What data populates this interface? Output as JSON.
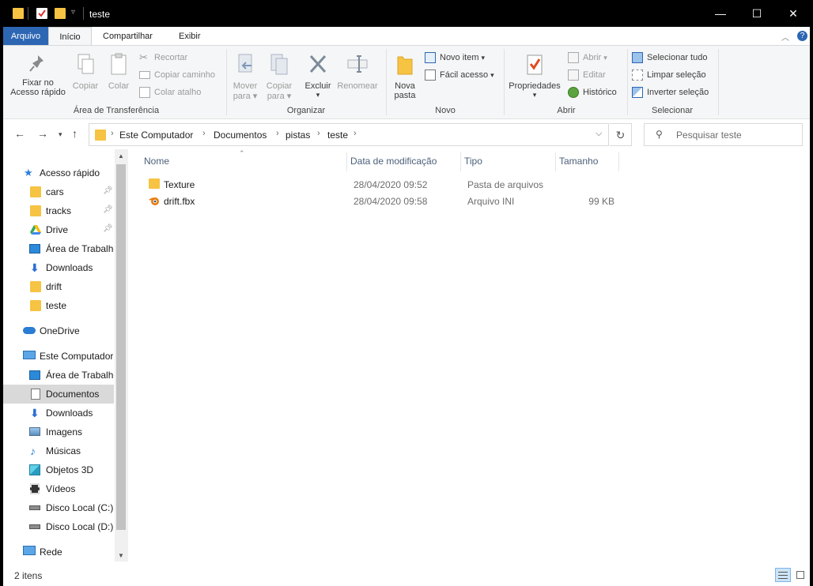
{
  "window": {
    "title": "teste"
  },
  "title_buttons": {
    "minimize": "—",
    "maximize": "☐",
    "close": "✕"
  },
  "ribbon_tabs": [
    "Arquivo",
    "Início",
    "Compartilhar",
    "Exibir"
  ],
  "ribbon": {
    "clipboard": {
      "pin_label_1": "Fixar no",
      "pin_label_2": "Acesso rápido",
      "copy": "Copiar",
      "paste": "Colar",
      "cut": "Recortar",
      "copy_path": "Copiar caminho",
      "paste_shortcut": "Colar atalho",
      "title": "Área de Transferência"
    },
    "organize": {
      "move_1": "Mover",
      "move_2": "para",
      "copyto_1": "Copiar",
      "copyto_2": "para",
      "delete": "Excluir",
      "rename": "Renomear",
      "title": "Organizar"
    },
    "new": {
      "newfolder_1": "Nova",
      "newfolder_2": "pasta",
      "new_item": "Novo item",
      "easy_access": "Fácil acesso",
      "title": "Novo"
    },
    "open": {
      "properties": "Propriedades",
      "open": "Abrir",
      "edit": "Editar",
      "history": "Histórico",
      "title": "Abrir"
    },
    "select": {
      "select_all": "Selecionar tudo",
      "clear": "Limpar seleção",
      "invert": "Inverter seleção",
      "title": "Selecionar"
    }
  },
  "address": {
    "crumbs": [
      "Este Computador",
      "Documentos",
      "pistas",
      "teste"
    ],
    "search_placeholder": "Pesquisar teste"
  },
  "nav": {
    "quick_access": "Acesso rápido",
    "quick_items": [
      "cars",
      "tracks",
      "Drive",
      "Área de Trabalho",
      "Downloads",
      "drift",
      "teste"
    ],
    "onedrive": "OneDrive",
    "this_pc": "Este Computador",
    "pc_items": [
      "Área de Trabalho",
      "Documentos",
      "Downloads",
      "Imagens",
      "Músicas",
      "Objetos 3D",
      "Vídeos",
      "Disco Local (C:)",
      "Disco Local (D:)"
    ],
    "network": "Rede"
  },
  "columns": [
    "Nome",
    "Data de modificação",
    "Tipo",
    "Tamanho"
  ],
  "files": [
    {
      "name": "Texture",
      "date": "28/04/2020 09:52",
      "type": "Pasta de arquivos",
      "size": "",
      "icon": "folder-icon"
    },
    {
      "name": "drift.fbx",
      "date": "28/04/2020 09:58",
      "type": "Arquivo INI",
      "size": "99 KB",
      "icon": "blender-icon"
    }
  ],
  "status": {
    "count": "2 itens"
  },
  "colors": {
    "accent": "#2d66b3",
    "folder": "#f6c343",
    "selection": "#d9d9d9"
  }
}
